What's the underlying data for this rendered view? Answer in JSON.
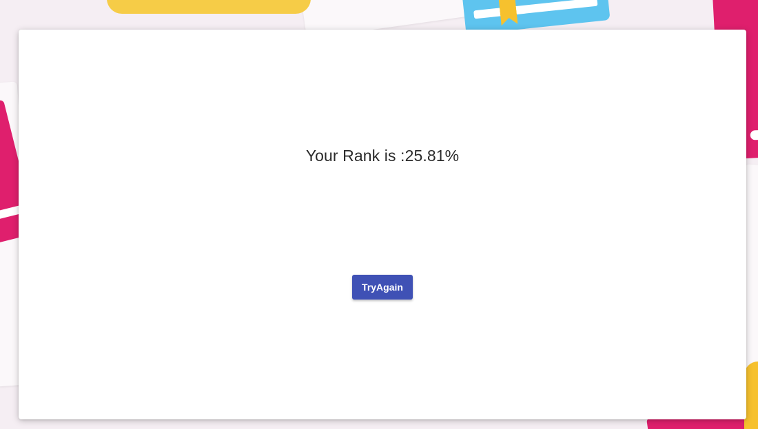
{
  "result": {
    "rank_label": "Your Rank is :",
    "rank_value": "25.81%"
  },
  "actions": {
    "try_again_label": "TryAgain"
  },
  "colors": {
    "button": "#3f51b5",
    "background": "#f5eef3",
    "notebook": "#f6cc47",
    "book_blue": "#5ec4ef",
    "book_pink": "#df1f6d"
  }
}
